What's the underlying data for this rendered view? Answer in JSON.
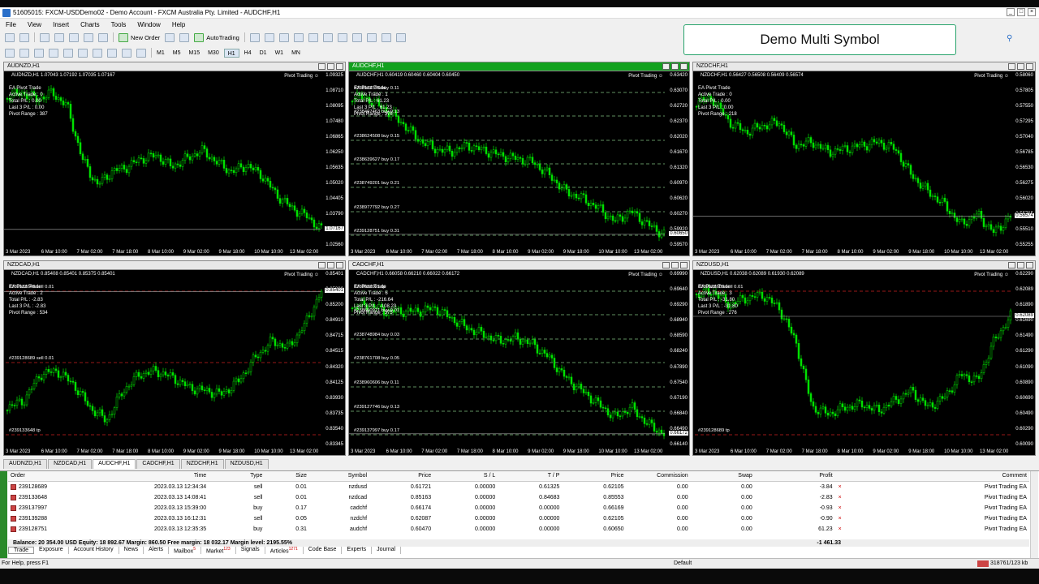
{
  "window": {
    "title": "51605015: FXCM-USDDemo02 - Demo Account - FXCM Australia Pty. Limited - AUDCHF,H1"
  },
  "menu": [
    "File",
    "View",
    "Insert",
    "Charts",
    "Tools",
    "Window",
    "Help"
  ],
  "toolbar": {
    "new_order": "New Order",
    "autotrading": "AutoTrading",
    "timeframes": [
      "M1",
      "M5",
      "M15",
      "M30",
      "H1",
      "H4",
      "D1",
      "W1",
      "MN"
    ],
    "active_timeframe": "H1"
  },
  "banner": {
    "text": "Demo Multi Symbol"
  },
  "colors": {
    "candle": "#00e000",
    "active_title": "#12a11e",
    "banner_border": "#27a36b",
    "trade_line": "#7fbf7f",
    "sell_line": "#cc2222"
  },
  "charts": [
    {
      "title": "AUDNZD,H1",
      "symline": "AUDNZD,H1 1.07043 1.07192 1.07035 1.07167",
      "pivot": "Pivot Trading",
      "ea": [
        "EA Pivot Trade",
        "Active Trade : 0",
        "Total P/L : 0.00",
        "Last 3 P/L : 0.00",
        "Pivot Range : 387"
      ],
      "prices": [
        "1.09325",
        "1.08710",
        "1.08095",
        "1.07480",
        "1.06865",
        "1.06250",
        "1.05635",
        "1.05020",
        "1.04405",
        "1.03790",
        "1.03175",
        "1.02560"
      ],
      "cur": "1.07167",
      "times": [
        "3 Mar 2023",
        "6 Mar 10:00",
        "7 Mar 02:00",
        "7 Mar 18:00",
        "8 Mar 10:00",
        "9 Mar 02:00",
        "9 Mar 18:00",
        "10 Mar 10:00",
        "13 Mar 02:00"
      ],
      "trades": []
    },
    {
      "title": "AUDCHF,H1",
      "symline": "AUDCHF,H1 0.60419 0.60460 0.60404 0.60450",
      "pivot": "Pivot Trading",
      "ea": [
        "EA Pivot Trade",
        "Active Trade : 1",
        "Total P/L : 61.23",
        "Last 3 P/L : 61.23",
        "Pivot Range : 376"
      ],
      "prices": [
        "0.63420",
        "0.63070",
        "0.62720",
        "0.62370",
        "0.62020",
        "0.61670",
        "0.61320",
        "0.60970",
        "0.60620",
        "0.60270",
        "0.59920",
        "0.59570"
      ],
      "cur": "0.60650",
      "times": [
        "3 Mar 2023",
        "6 Mar 10:00",
        "7 Mar 02:00",
        "7 Mar 18:00",
        "8 Mar 10:00",
        "9 Mar 02:00",
        "9 Mar 18:00",
        "10 Mar 10:00",
        "13 Mar 02:00"
      ],
      "trades": [
        "#238102576 buy 0.11",
        "#238497463 buy 0.13",
        "#238624508 buy 0.15",
        "#238639627 buy 0.17",
        "#238749201 buy 0.21",
        "#238977792 buy 0.27",
        "#239128751 buy 0.31"
      ]
    },
    {
      "title": "NZDCHF,H1",
      "symline": "NZDCHF,H1 0.56427 0.56508 0.56409 0.56574",
      "pivot": "Pivot Trading",
      "ea": [
        "EA Pivot Trade",
        "Active Trade : 0",
        "Total P/L : 0.00",
        "Last 3 P/L : 0.00",
        "Pivot Range : 218"
      ],
      "prices": [
        "0.58060",
        "0.57805",
        "0.57550",
        "0.57295",
        "0.57040",
        "0.56785",
        "0.56530",
        "0.56275",
        "0.56020",
        "0.55765",
        "0.55510",
        "0.55255"
      ],
      "cur": "0.56574",
      "times": [
        "3 Mar 2023",
        "6 Mar 10:00",
        "7 Mar 02:00",
        "7 Mar 18:00",
        "8 Mar 10:00",
        "9 Mar 02:00",
        "9 Mar 18:00",
        "10 Mar 10:00",
        "13 Mar 02:00"
      ],
      "trades": []
    },
    {
      "title": "NZDCAD,H1",
      "symline": "NZDCAD,H1 0.85408 0.85401 0.85375 0.85401",
      "pivot": "Pivot Trading",
      "ea": [
        "EA Pivot Trade",
        "Active Trade : 2",
        "Total P/L : -2.83",
        "Last 3 P/L : -2.83",
        "Pivot Range : 534"
      ],
      "prices": [
        "0.85401",
        "0.85300",
        "0.85200",
        "0.84910",
        "0.84715",
        "0.84515",
        "0.84320",
        "0.84125",
        "0.83930",
        "0.83735",
        "0.83540",
        "0.83345"
      ],
      "cur": "0.85401",
      "times": [
        "3 Mar 2023",
        "6 Mar 10:00",
        "7 Mar 02:00",
        "7 Mar 18:00",
        "8 Mar 10:00",
        "9 Mar 02:00",
        "9 Mar 18:00",
        "10 Mar 10:00",
        "13 Mar 02:00"
      ],
      "trades": [
        "#239133648 sell 0.01",
        "#239128689 sell 0.01",
        "#239133648 tp"
      ]
    },
    {
      "title": "CADCHF,H1",
      "symline": "CADCHF,H1 0.66058 0.66210 0.66022 0.66172",
      "pivot": "Pivot Trading",
      "ea": [
        "EA Pivot Trade",
        "Active Trade : 6",
        "Total P/L : -216.64",
        "Last 3 P/L : -108.23",
        "Pivot Range : 375"
      ],
      "prices": [
        "0.69990",
        "0.69640",
        "0.69290",
        "0.68940",
        "0.68590",
        "0.68240",
        "0.67890",
        "0.67540",
        "0.67190",
        "0.66840",
        "0.66490",
        "0.66140"
      ],
      "cur": "0.66172",
      "times": [
        "3 Mar 2023",
        "6 Mar 10:00",
        "7 Mar 02:00",
        "7 Mar 18:00",
        "8 Mar 10:00",
        "9 Mar 02:00",
        "9 Mar 18:00",
        "10 Mar 10:00",
        "13 Mar 02:00"
      ],
      "trades": [
        "#238650921 tp",
        "#238650921 buy 0.01",
        "#238748984 buy 0.03",
        "#238761708 buy 0.05",
        "#238960606 buy 0.11",
        "#239127746 buy 0.13",
        "#239137997 buy 0.17"
      ]
    },
    {
      "title": "NZDUSD,H1",
      "symline": "NZDUSD,H1 0.62038 0.62089 0.61930 0.62089",
      "pivot": "Pivot Trading",
      "ea": [
        "EA Pivot Trade",
        "Active Trade : 3",
        "Total P/L : -31.80",
        "Last 3 P/L : -31.80",
        "Pivot Range : 276"
      ],
      "prices": [
        "0.62290",
        "0.62089",
        "0.61890",
        "0.61690",
        "0.61490",
        "0.61290",
        "0.61090",
        "0.60890",
        "0.60690",
        "0.60490",
        "0.60290",
        "0.60090"
      ],
      "cur": "0.62089",
      "times": [
        "3 Mar 2023",
        "6 Mar 10:00",
        "7 Mar 02:00",
        "7 Mar 18:00",
        "8 Mar 10:00",
        "9 Mar 02:00",
        "9 Mar 18:00",
        "10 Mar 10:00",
        "13 Mar 02:00"
      ],
      "trades": [
        "#239128689 sell 0.01",
        "#239128689 tp"
      ]
    }
  ],
  "chart_tabs": [
    "AUDNZD,H1",
    "NZDCAD,H1",
    "AUDCHF,H1",
    "CADCHF,H1",
    "NZDCHF,H1",
    "NZDUSD,H1"
  ],
  "active_chart_tab": "AUDCHF,H1",
  "terminal": {
    "headers": [
      "Order",
      "Time",
      "Type",
      "Size",
      "Symbol",
      "Price",
      "S / L",
      "T / P",
      "Price",
      "Commission",
      "Swap",
      "Profit",
      "Comment"
    ],
    "rows": [
      [
        "239128689",
        "2023.03.13 12:34:34",
        "sell",
        "0.01",
        "nzdusd",
        "0.61721",
        "0.00000",
        "0.61325",
        "0.62105",
        "0.00",
        "0.00",
        "-3.84",
        "Pivot Trading EA"
      ],
      [
        "239133648",
        "2023.03.13 14:08:41",
        "sell",
        "0.01",
        "nzdcad",
        "0.85163",
        "0.00000",
        "0.84683",
        "0.85553",
        "0.00",
        "0.00",
        "-2.83",
        "Pivot Trading EA"
      ],
      [
        "239137997",
        "2023.03.13 15:39:00",
        "buy",
        "0.17",
        "cadchf",
        "0.66174",
        "0.00000",
        "0.00000",
        "0.66169",
        "0.00",
        "0.00",
        "-0.93",
        "Pivot Trading EA"
      ],
      [
        "239139288",
        "2023.03.13 16:12:31",
        "sell",
        "0.05",
        "nzdchf",
        "0.62087",
        "0.00000",
        "0.00000",
        "0.62105",
        "0.00",
        "0.00",
        "-0.90",
        "Pivot Trading EA"
      ],
      [
        "239128751",
        "2023.03.13 12:35:35",
        "buy",
        "0.31",
        "audchf",
        "0.60470",
        "0.00000",
        "0.00000",
        "0.60650",
        "0.00",
        "0.00",
        "61.23",
        "Pivot Trading EA"
      ]
    ],
    "balance": "Balance: 20 354.00 USD  Equity: 18 892.67  Margin: 860.50  Free margin: 18 032.17  Margin level: 2195.55%",
    "total": "-1 461.33",
    "tabs": [
      "Trade",
      "Exposure",
      "Account History",
      "News",
      "Alerts",
      "Mailbox",
      "Market",
      "Signals",
      "Articles",
      "Code Base",
      "Experts",
      "Journal"
    ],
    "tab_badges": {
      "Mailbox": "5",
      "Market": "123",
      "Articles": "1271"
    },
    "active_tab": "Trade"
  },
  "status": {
    "help": "For Help, press F1",
    "profile": "Default",
    "conn": "318761/123 kb"
  }
}
